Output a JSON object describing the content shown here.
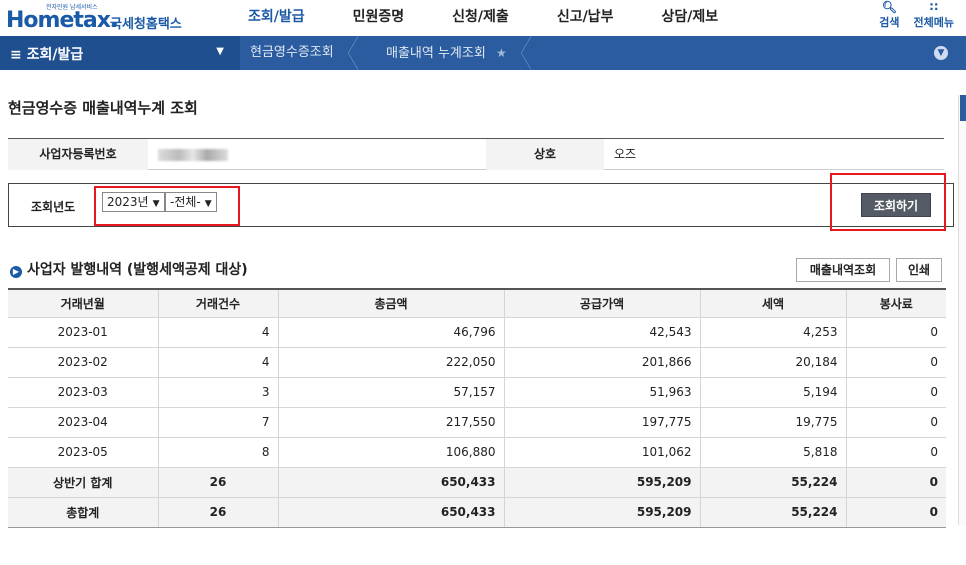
{
  "header": {
    "logo_small": "전자민원 납세서비스",
    "logo_brand": "Hometax.",
    "logo_korean": "국세청홈택스",
    "nav": [
      "조회/발급",
      "민원증명",
      "신청/제출",
      "신고/납부",
      "상담/제보"
    ],
    "tools": [
      {
        "icon": "search-icon",
        "label": "검색"
      },
      {
        "icon": "grid-menu-icon",
        "label": "전체메뉴"
      }
    ]
  },
  "menubar": {
    "menu_label": "≡ 조회/발급",
    "breadcrumbs": [
      "현금영수증조회",
      "매출내역 누계조회"
    ]
  },
  "page": {
    "title": "현금영수증 매출내역누계 조회"
  },
  "info": {
    "bizno_label": "사업자등록번호",
    "bizno_value": "",
    "name_label": "상호",
    "name_value": "오즈"
  },
  "search": {
    "year_label": "조회년도",
    "year_selected": "2023년",
    "period_selected": "-전체-",
    "button": "조회하기"
  },
  "section": {
    "title": "사업자 발행내역 (발행세액공제 대상)",
    "btn_detail": "매출내역조회",
    "btn_print": "인쇄"
  },
  "table": {
    "headers": [
      "거래년월",
      "거래건수",
      "총금액",
      "공급가액",
      "세액",
      "봉사료"
    ],
    "rows": [
      [
        "2023-01",
        "4",
        "46,796",
        "42,543",
        "4,253",
        "0"
      ],
      [
        "2023-02",
        "4",
        "222,050",
        "201,866",
        "20,184",
        "0"
      ],
      [
        "2023-03",
        "3",
        "57,157",
        "51,963",
        "5,194",
        "0"
      ],
      [
        "2023-04",
        "7",
        "217,550",
        "197,775",
        "19,775",
        "0"
      ],
      [
        "2023-05",
        "8",
        "106,880",
        "101,062",
        "5,818",
        "0"
      ]
    ],
    "subtotal": [
      "상반기 합계",
      "26",
      "650,433",
      "595,209",
      "55,224",
      "0"
    ],
    "total": [
      "총합계",
      "26",
      "650,433",
      "595,209",
      "55,224",
      "0"
    ]
  },
  "colors": {
    "brand": "#1b5aa6",
    "bar": "#2b5c9f",
    "highlight": "#e8161d"
  }
}
